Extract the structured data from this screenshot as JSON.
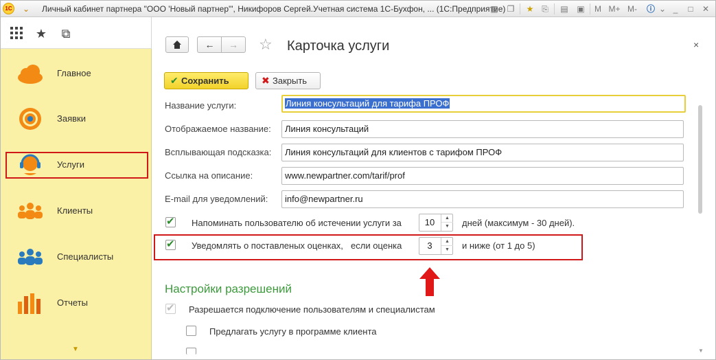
{
  "titlebar": {
    "title": "Личный кабинет партнера \"ООО 'Новый партнер'\", Никифоров Сергей.Учетная система 1С-Бухфон, ...  (1С:Предприятие)",
    "logo_text": "1С",
    "memory_buttons": [
      "M",
      "M+",
      "M-"
    ]
  },
  "sections": {
    "items": [
      {
        "label": "Главное",
        "icon": "cloud-icon"
      },
      {
        "label": "Заявки",
        "icon": "target-icon"
      },
      {
        "label": "Услуги",
        "icon": "headset-icon",
        "selected": true
      },
      {
        "label": "Клиенты",
        "icon": "people-icon"
      },
      {
        "label": "Специалисты",
        "icon": "specialists-icon"
      },
      {
        "label": "Отчеты",
        "icon": "bar-chart-icon"
      }
    ]
  },
  "form": {
    "title": "Карточка услуги",
    "close_symbol": "×",
    "save_label": "Сохранить",
    "close_label": "Закрыть",
    "fields": [
      {
        "label": "Название услуги:",
        "value": "Линия консультаций для тарифа ПРОФ"
      },
      {
        "label": "Отображаемое название:",
        "value": "Линия консультаций"
      },
      {
        "label": "Всплывающая подсказка:",
        "value": "Линия консультаций для клиентов с тарифом ПРОФ"
      },
      {
        "label": "Ссылка на описание:",
        "value": "www.newpartner.com/tarif/prof"
      },
      {
        "label": "E-mail для уведомлений:",
        "value": "info@newpartner.ru"
      }
    ],
    "remind": {
      "checked": true,
      "label": "Напоминать пользователю об истечении услуги за",
      "value": "10",
      "suffix": "дней (максимум - 30 дней)."
    },
    "rating": {
      "checked": true,
      "label": "Уведомлять о поставленых оценках,",
      "label2": "если оценка",
      "value": "3",
      "suffix": "и ниже (от 1 до 5)"
    },
    "permissions": {
      "title": "Настройки разрешений",
      "allow_label": "Разрешается подключение пользователям и специалистам",
      "allow_checked": true,
      "offer_label": "Предлагать услугу в программе клиента",
      "offer_checked": false
    }
  },
  "colors": {
    "sections_bg": "#fbf1a6",
    "highlight": "#d01818",
    "accent_green": "#3c9a3c",
    "save_yellow": "#f2d22a"
  }
}
